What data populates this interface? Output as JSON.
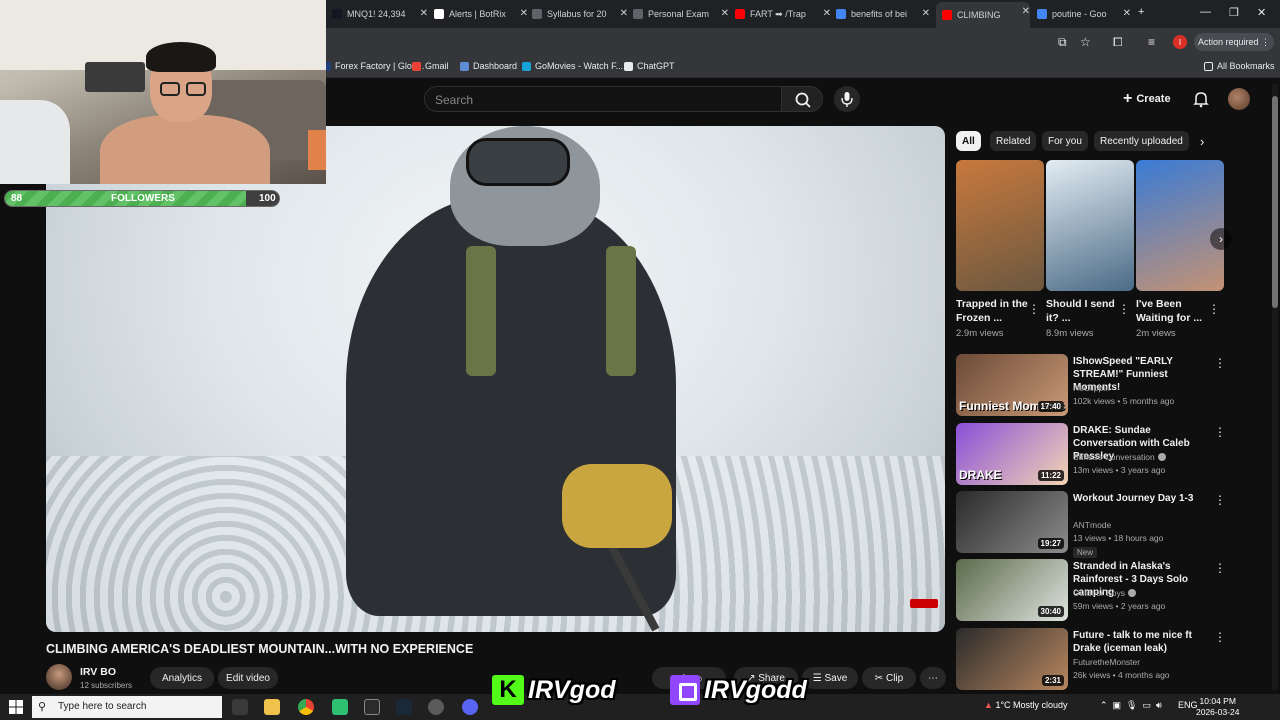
{
  "browser": {
    "tabs": [
      {
        "label": "MNQ1! 24,394",
        "color": "#131722"
      },
      {
        "label": "Alerts | BotRix",
        "color": "#ffffff"
      },
      {
        "label": "Syllabus for 20",
        "color": "#5f6368"
      },
      {
        "label": "Personal Exam",
        "color": "#5f6368"
      },
      {
        "label": "FART ➡ /Trap",
        "color": "#ff0000"
      },
      {
        "label": "benefits of bei",
        "color": "#4285f4"
      },
      {
        "label": "CLIMBING",
        "color": "#ff0000"
      },
      {
        "label": "poutine - Goo",
        "color": "#4285f4"
      }
    ],
    "new_tab": "+",
    "action_required": "Action required",
    "profile_initial": "I",
    "bookmarks": [
      {
        "label": "Forex Factory | Glob...",
        "color": "#1f3d7a"
      },
      {
        "label": "Gmail",
        "color": "#ea4335"
      },
      {
        "label": "Dashboard",
        "color": "#5f8dd3"
      },
      {
        "label": "GoMovies - Watch F...",
        "color": "#16a3d8"
      },
      {
        "label": "ChatGPT",
        "color": "#e8eaed"
      }
    ],
    "all_bookmarks": "All Bookmarks"
  },
  "stream": {
    "followers_label": "FOLLOWERS",
    "followers_current": "88",
    "followers_goal": "100",
    "followers_progress": 0.88,
    "kick_name": "IRVgod",
    "twitch_name": "IRVgodd"
  },
  "youtube": {
    "search_placeholder": "Search",
    "create_label": "Create",
    "video_title": "CLIMBING AMERICA'S DEADLIEST MOUNTAIN...WITH NO EXPERIENCE",
    "channel_name": "IRV BO",
    "channel_subs": "12 subscribers",
    "analytics_label": "Analytics",
    "edit_video_label": "Edit video",
    "share_label": "Share",
    "save_label": "Save",
    "clip_label": "Clip",
    "chips": [
      "All",
      "Related",
      "For you",
      "Recently uploaded"
    ],
    "shorts": [
      {
        "title": "Trapped in the Frozen ...",
        "views": "2.9m views",
        "color1": "#c8793d",
        "color2": "#6b5840"
      },
      {
        "title": "Should I send it? ...",
        "views": "8.9m views",
        "color1": "#e3ecf3",
        "color2": "#4b6b86"
      },
      {
        "title": "I've Been Waiting for ...",
        "views": "2m views",
        "color1": "#3a7bd5",
        "color2": "#c49274"
      }
    ],
    "recommendations": [
      {
        "title": "IShowSpeed \"EARLY STREAM!\" Funniest Moments!",
        "channel": "HeClippin",
        "meta": "102k views • 5 months ago",
        "duration": "17:40",
        "thumb_text": "Funniest Moments",
        "color1": "#6c4a36",
        "color2": "#c89977",
        "verified": false,
        "badge": ""
      },
      {
        "title": "DRAKE: Sundae Conversation with Caleb Pressley",
        "channel": "Sundae Conversation",
        "meta": "13m views • 3 years ago",
        "duration": "11:22",
        "thumb_text": "DRAKE",
        "color1": "#8a4fd8",
        "color2": "#f2d3b3",
        "verified": true,
        "badge": ""
      },
      {
        "title": "Workout Journey Day 1-3",
        "channel": "ANTmode",
        "meta": "13 views • 18 hours ago",
        "duration": "19:27",
        "thumb_text": "",
        "color1": "#2a2a2a",
        "color2": "#8c8c8c",
        "verified": false,
        "badge": "New"
      },
      {
        "title": "Stranded in Alaska's Rainforest - 3 Days Solo camping",
        "channel": "Outdoor Boys",
        "meta": "59m views • 2 years ago",
        "duration": "30:40",
        "thumb_text": "",
        "color1": "#5a6b4a",
        "color2": "#dfe3e0",
        "verified": true,
        "badge": ""
      },
      {
        "title": "Future - talk to me nice ft Drake (iceman leak)",
        "channel": "FuturetheMonster",
        "meta": "26k views • 4 months ago",
        "duration": "2:31",
        "thumb_text": "",
        "color1": "#2b2b2b",
        "color2": "#b8875f",
        "verified": false,
        "badge": ""
      }
    ]
  },
  "taskbar": {
    "search_placeholder": "Type here to search",
    "weather": "1°C  Mostly cloudy",
    "language": "ENG",
    "time": "10:04 PM",
    "date": "2026-03-24"
  }
}
